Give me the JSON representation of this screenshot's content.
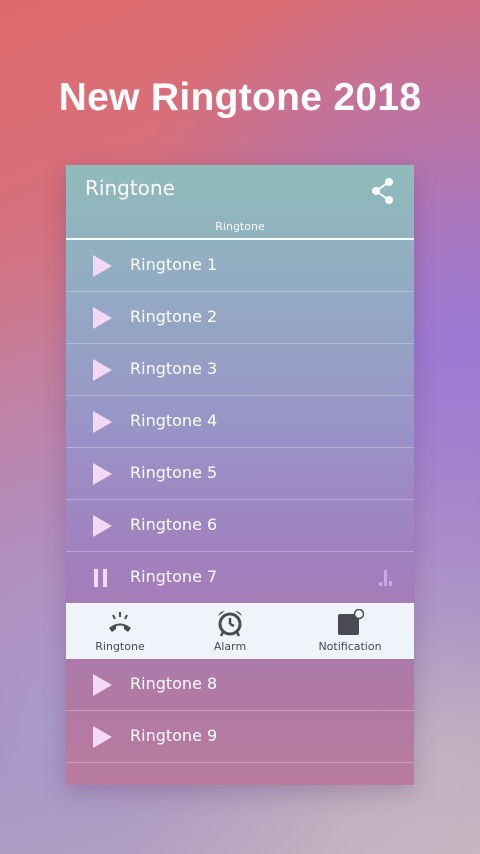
{
  "headline": "New Ringtone 2018",
  "app": {
    "title": "Ringtone",
    "tab": "Ringtone"
  },
  "ringtones": [
    {
      "label": "Ringtone 1",
      "state": "play"
    },
    {
      "label": "Ringtone 2",
      "state": "play"
    },
    {
      "label": "Ringtone 3",
      "state": "play"
    },
    {
      "label": "Ringtone 4",
      "state": "play"
    },
    {
      "label": "Ringtone 5",
      "state": "play"
    },
    {
      "label": "Ringtone 6",
      "state": "play"
    },
    {
      "label": "Ringtone 7",
      "state": "pause"
    },
    {
      "label": "Ringtone 8",
      "state": "play"
    },
    {
      "label": "Ringtone 9",
      "state": "play"
    }
  ],
  "actions": {
    "ringtone": "Ringtone",
    "alarm": "Alarm",
    "notification": "Notification"
  },
  "colors": {
    "play_icon": "#f3d9f5",
    "action_bar": "#eef4fa",
    "action_icon": "#4a4a52",
    "eq_icon": "#c9a8e8"
  }
}
